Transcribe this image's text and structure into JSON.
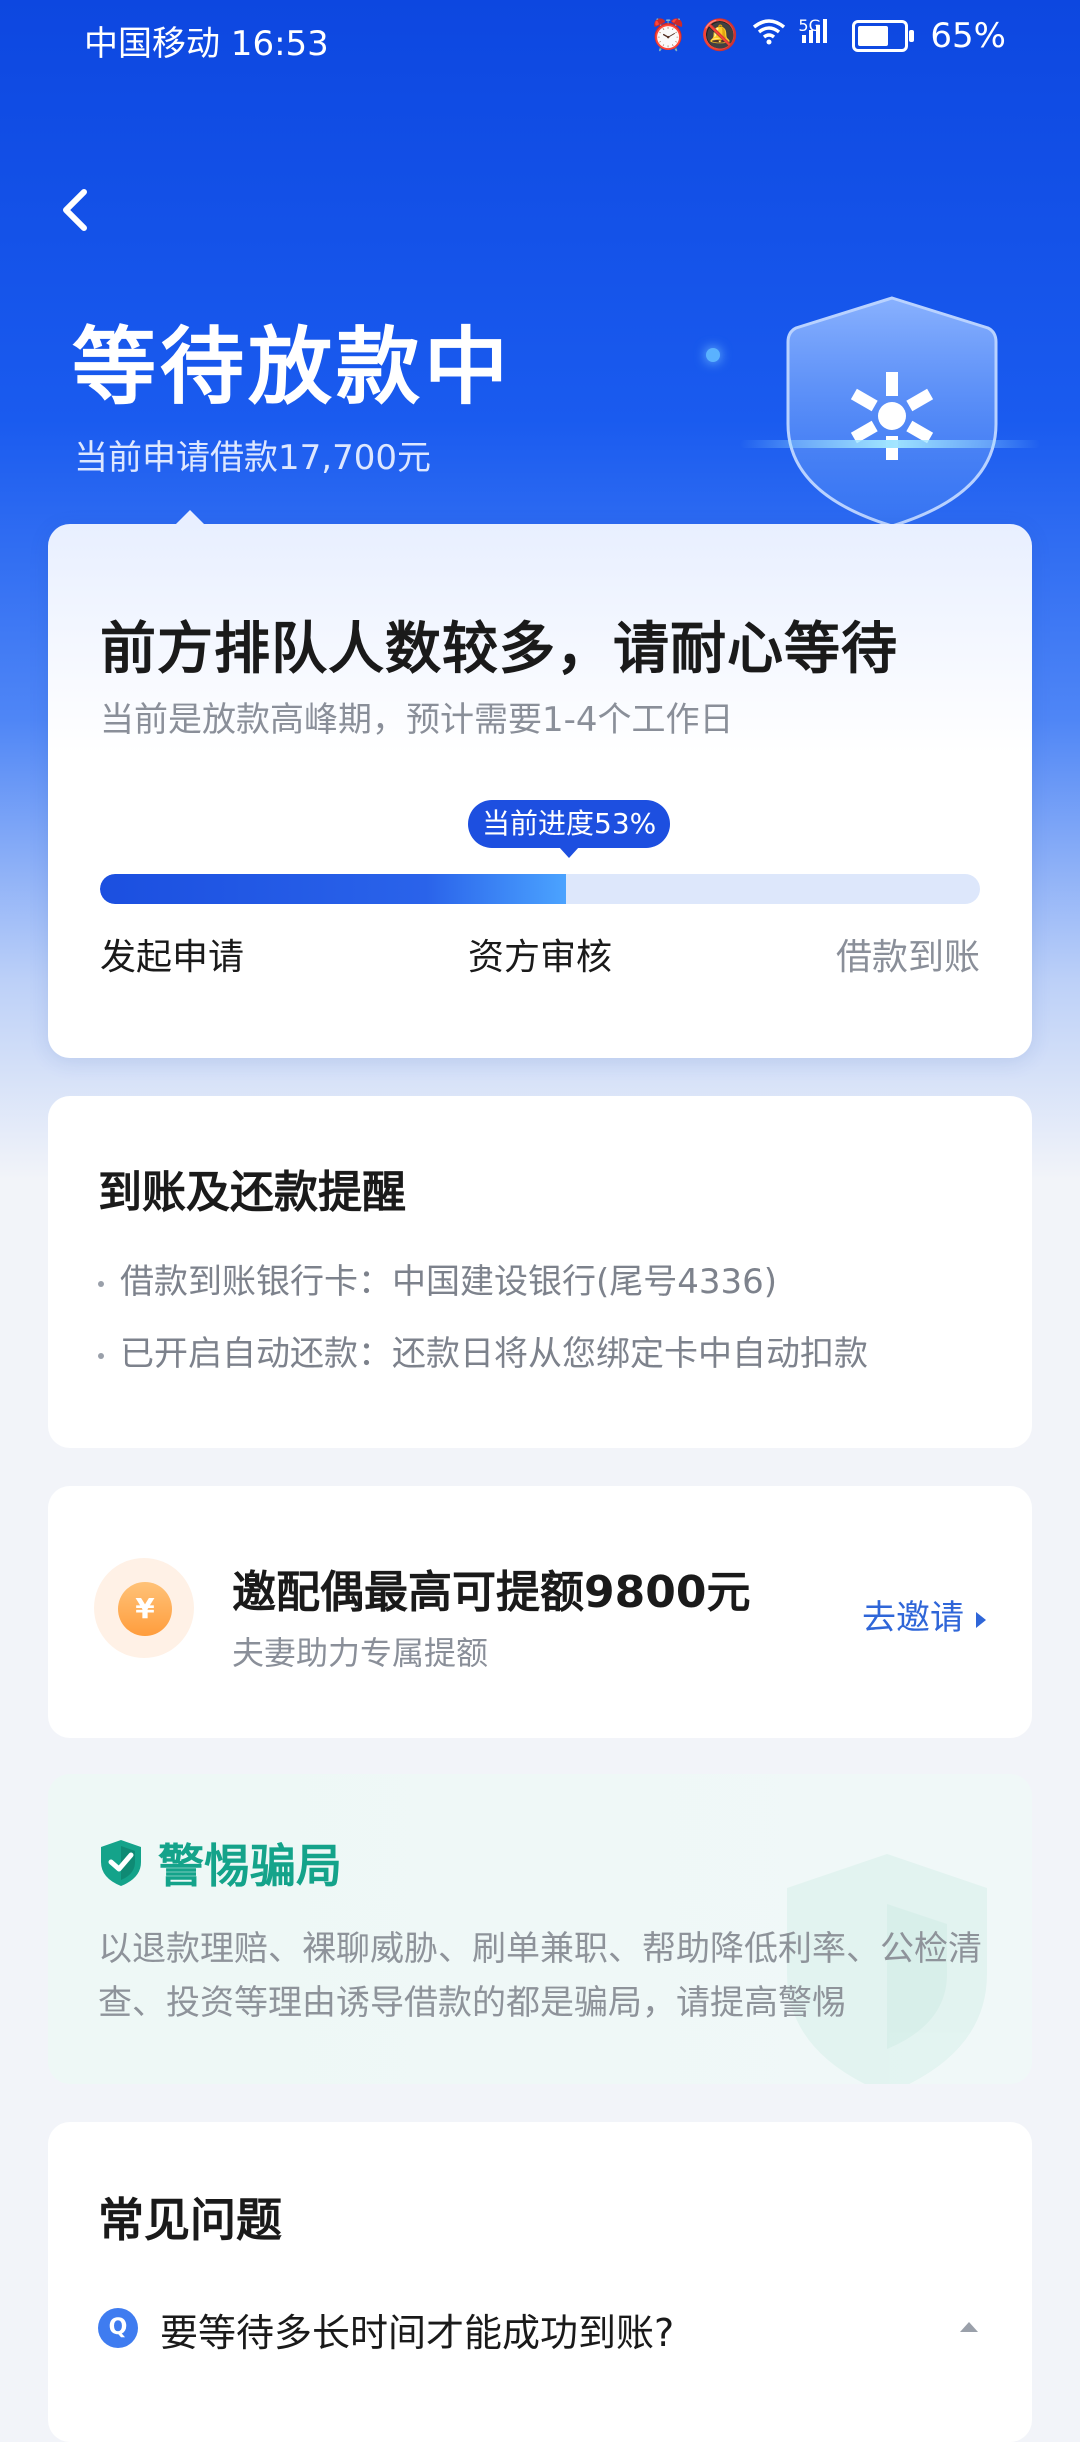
{
  "status_bar": {
    "carrier_time": "中国移动 16:53",
    "network": "5G",
    "battery": "65%",
    "icons": [
      "alarm-icon",
      "mute-icon",
      "wifi-icon",
      "signal-icon",
      "battery-icon"
    ]
  },
  "header": {
    "title": "等待放款中",
    "subtitle": "当前申请借款17,700元"
  },
  "progress_card": {
    "heading": "前方排队人数较多，请耐心等待",
    "note": "当前是放款高峰期，预计需要1-4个工作日",
    "progress_label": "当前进度53%",
    "progress_value": 53,
    "steps": [
      "发起申请",
      "资方审核",
      "借款到账"
    ]
  },
  "reminder_card": {
    "title": "到账及还款提醒",
    "items": [
      "借款到账银行卡：中国建设银行(尾号4336)",
      "已开启自动还款：还款日将从您绑定卡中自动扣款"
    ]
  },
  "invite_card": {
    "coin_symbol": "¥",
    "title": "邀配偶最高可提额9800元",
    "subtitle": "夫妻助力专属提额",
    "action": "去邀请"
  },
  "warning_card": {
    "title": "警惕骗局",
    "text": "以退款理赔、裸聊威胁、刷单兼职、帮助降低利率、公检清查、投资等理由诱导借款的都是骗局，请提高警惕"
  },
  "faq_card": {
    "title": "常见问题",
    "badge": "Q",
    "question": "要等待多长时间才能成功到账?"
  },
  "colors": {
    "brand_blue": "#1d4fe0",
    "warning_green": "#14a38a",
    "action_blue": "#2f66d8"
  }
}
